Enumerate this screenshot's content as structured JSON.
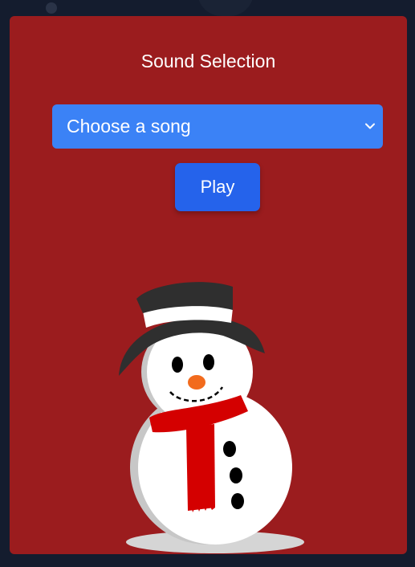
{
  "panel": {
    "title": "Sound Selection"
  },
  "song_select": {
    "selected": "Choose a song",
    "icon": "chevron-down-icon"
  },
  "play_button": {
    "label": "Play"
  },
  "illustration": {
    "name": "snowman",
    "colors": {
      "panel_background": "#9b1c1e",
      "page_background": "#141c2e",
      "select_background": "#3b82f6",
      "button_background": "#2563eb",
      "scarf": "#d40000",
      "nose": "#f26b1d",
      "hat": "#2f2f2f"
    }
  }
}
